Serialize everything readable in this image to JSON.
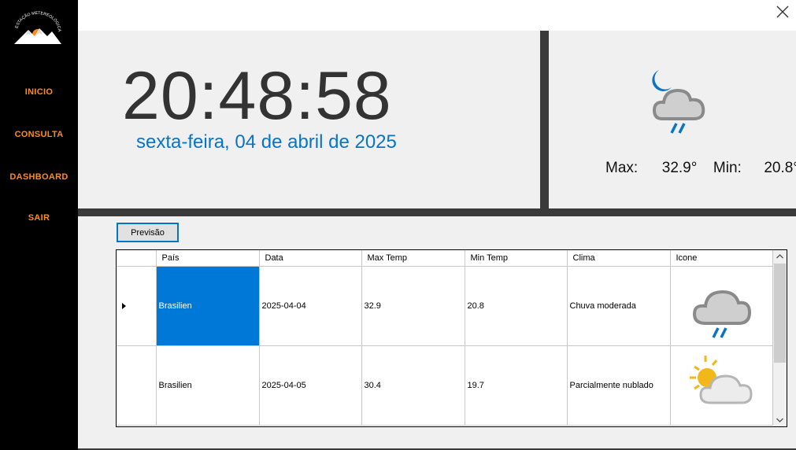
{
  "sidebar": {
    "logo_alt": "ESTAÇÃO METEREOLÓGICA",
    "items": [
      {
        "label": "INICIO"
      },
      {
        "label": "CONSULTA"
      },
      {
        "label": "DASHBOARD"
      },
      {
        "label": "SAIR"
      }
    ]
  },
  "clock": {
    "time": "20:48:58",
    "date": "sexta-feira, 04 de abril de 2025"
  },
  "weather": {
    "icon": "night-rain-icon",
    "max_label": "Max:",
    "max_value": "32.9°",
    "min_label": "Min:",
    "min_value": "20.8°"
  },
  "forecast_button": "Previsão",
  "grid": {
    "columns": [
      "País",
      "Data",
      "Max Temp",
      "Min Temp",
      "Clima",
      "Icone"
    ],
    "rows": [
      {
        "pais": "Brasilien",
        "data": "2025-04-04",
        "max": "32.9",
        "min": "20.8",
        "clima": "Chuva moderada",
        "icon": "rain-cloud-icon",
        "selected": true
      },
      {
        "pais": "Brasilien",
        "data": "2025-04-05",
        "max": "30.4",
        "min": "19.7",
        "clima": "Parcialmente nublado",
        "icon": "partly-cloudy-icon",
        "selected": false
      }
    ]
  },
  "colors": {
    "sidebar_bg": "#000000",
    "nav_text": "#ff8c1a",
    "date_text": "#0a74c4",
    "selection": "#0078d7",
    "panel_bg": "#f0f0f0",
    "divider": "#3a3a3a"
  }
}
